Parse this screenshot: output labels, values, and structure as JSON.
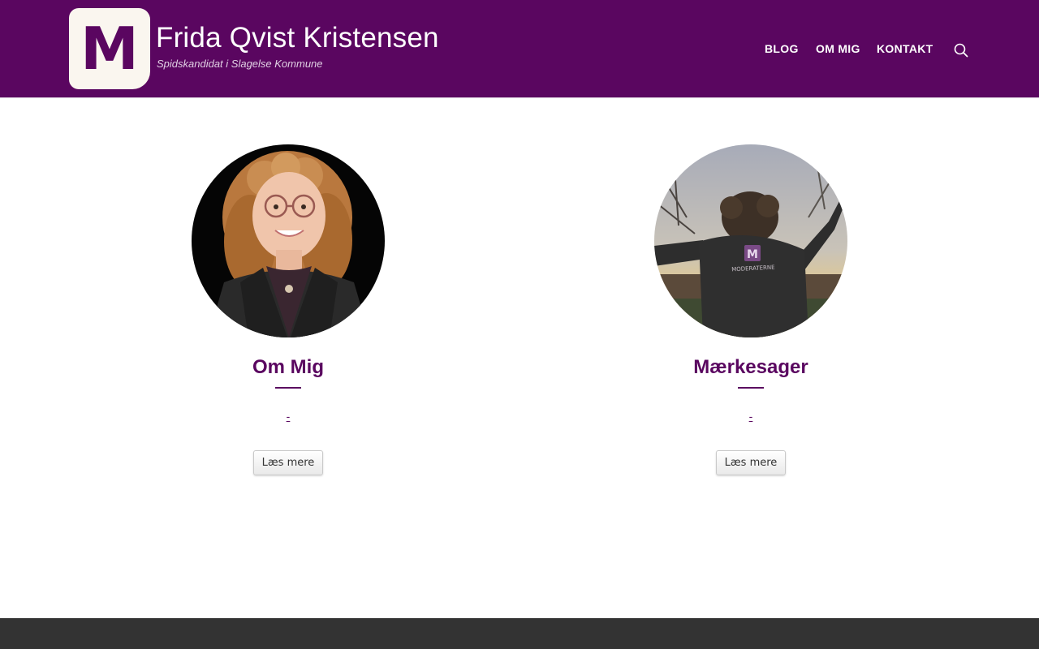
{
  "colors": {
    "brand": "#5a0660",
    "header_bg": "#5a0660",
    "logo_bg": "#faf6ef",
    "footer_bg": "#333333"
  },
  "header": {
    "logo_letter": "M",
    "site_title": "Frida Qvist Kristensen",
    "tagline": "Spidskandidat i Slagelse Kommune",
    "nav": [
      {
        "label": "BLOG"
      },
      {
        "label": "OM MIG"
      },
      {
        "label": "KONTAKT"
      }
    ],
    "search_icon": "search-icon"
  },
  "cards": [
    {
      "title": "Om Mig",
      "excerpt": "-",
      "button_label": "Læs mere",
      "image": "portrait-photo"
    },
    {
      "title": "Mærkesager",
      "excerpt": "-",
      "button_label": "Læs mere",
      "image": "jacket-back-photo",
      "jacket_text": "MODERATERNE",
      "jacket_logo_letter": "M"
    }
  ]
}
